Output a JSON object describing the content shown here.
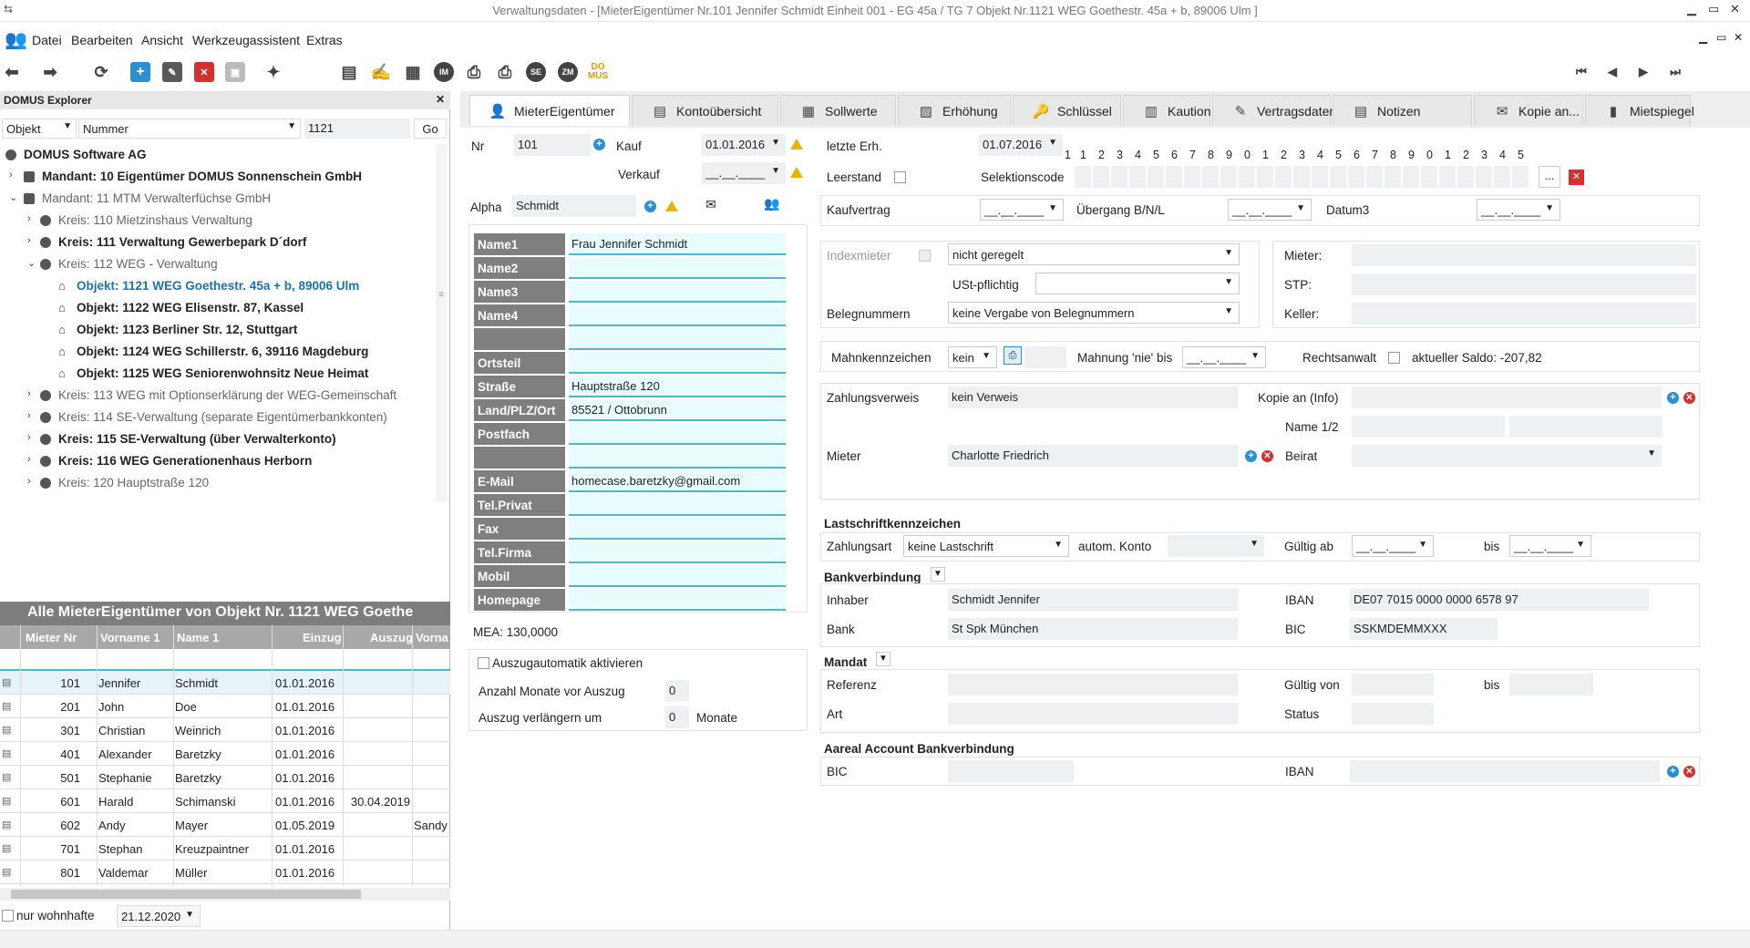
{
  "window": {
    "title": "Verwaltungsdaten - [MieterEigentümer Nr.101   Jennifer  Schmidt     Einheit   001 - EG  45a / TG 7     Objekt   Nr.1121   WEG Goethestr. 45a + b, 89006 Ulm ]"
  },
  "menu": [
    "Datei",
    "Bearbeiten",
    "Ansicht",
    "Werkzeugassistent",
    "Extras"
  ],
  "toolbar": {
    "badges": [
      "IM",
      "SE",
      "ZM"
    ],
    "logo": "DO MUS"
  },
  "explorer": {
    "header": "DOMUS Explorer",
    "filter": {
      "field": "Objekt",
      "mode": "Nummer",
      "value": "1121",
      "go": "Go"
    },
    "tree": [
      "DOMUS Software AG",
      "Mandant: 10 Eigentümer DOMUS Sonnenschein GmbH",
      "Mandant: 11 MTM Verwalterfüchse GmbH",
      "Kreis: 110 Mietzinshaus Verwaltung",
      "Kreis: 111 Verwaltung Gewerbepark D´dorf",
      "Kreis: 112 WEG - Verwaltung",
      "Objekt: 1121 WEG Goethestr. 45a + b, 89006 Ulm",
      "Objekt: 1122 WEG Elisenstr. 87, Kassel",
      "Objekt: 1123 Berliner Str. 12, Stuttgart",
      "Objekt: 1124 WEG Schillerstr. 6, 39116 Magdeburg",
      "Objekt: 1125 WEG Seniorenwohnsitz Neue Heimat",
      "Kreis: 113 WEG mit Optionserklärung der WEG-Gemeinschaft",
      "Kreis: 114 SE-Verwaltung (separate Eigentümerbankkonten)",
      "Kreis: 115 SE-Verwaltung (über Verwalterkonto)",
      "Kreis: 116 WEG Generationenhaus Herborn",
      "Kreis: 120 Hauptstraße 120"
    ],
    "grid": {
      "title": "Alle MieterEigentümer von Objekt Nr. 1121 WEG Goethe",
      "columns": [
        "Mieter Nr",
        "Vorname 1",
        "Name 1",
        "Einzug",
        "Auszug",
        "Vorna"
      ],
      "rows": [
        [
          "101",
          "Jennifer",
          "Schmidt",
          "01.01.2016",
          "",
          ""
        ],
        [
          "201",
          "John",
          "Doe",
          "01.01.2016",
          "",
          ""
        ],
        [
          "301",
          "Christian",
          "Weinrich",
          "01.01.2016",
          "",
          ""
        ],
        [
          "401",
          "Alexander",
          "Baretzky",
          "01.01.2016",
          "",
          ""
        ],
        [
          "501",
          "Stephanie",
          "Baretzky",
          "01.01.2016",
          "",
          ""
        ],
        [
          "601",
          "Harald",
          "Schimanski",
          "01.01.2016",
          "30.04.2019",
          ""
        ],
        [
          "602",
          "Andy",
          "Mayer",
          "01.05.2019",
          "",
          "Sandy"
        ],
        [
          "701",
          "Stephan",
          "Kreuzpaintner",
          "01.01.2016",
          "",
          ""
        ],
        [
          "801",
          "Valdemar",
          "Müller",
          "01.01.2016",
          "",
          ""
        ]
      ]
    },
    "footer": {
      "only_residents": "nur wohnhafte",
      "date": "21.12.2020"
    }
  },
  "tabs": [
    "MieterEigentümer",
    "Kontoübersicht",
    "Sollwerte",
    "Erhöhung",
    "Schlüssel",
    "Kaution",
    "Vertragsdaten",
    "Notizen",
    "Kopie an...",
    "Mietspiegel"
  ],
  "form": {
    "nr_label": "Nr",
    "nr": "101",
    "kauf_label": "Kauf",
    "kauf": "01.01.2016",
    "verkauf_label": "Verkauf",
    "verkauf": "__.__.____",
    "alpha_label": "Alpha",
    "alpha": "Schmidt",
    "letzte_erh_label": "letzte Erh.",
    "letzte_erh": "01.07.2016",
    "leerstand_label": "Leerstand",
    "selektionscode_label": "Selektionscode",
    "sel_numbers": [
      "1",
      "2",
      "3",
      "4",
      "5",
      "6",
      "7",
      "8",
      "9",
      "0",
      "1",
      "2",
      "3",
      "4",
      "5",
      "6",
      "7",
      "8",
      "9",
      "0",
      "1",
      "2",
      "3",
      "4",
      "5"
    ],
    "sel_more": "...",
    "kaufvertrag_label": "Kaufvertrag",
    "kaufvertrag": "__.__.____",
    "uebergang_label": "Übergang B/N/L",
    "uebergang": "__.__.____",
    "datum3_label": "Datum3",
    "datum3": "__.__.____",
    "name_labels": [
      "Name1",
      "Name2",
      "Name3",
      "Name4",
      "",
      "Ortsteil",
      "Straße",
      "Land/PLZ/Ort",
      "Postfach",
      "",
      "E-Mail",
      "Tel.Privat",
      "Fax",
      "Tel.Firma",
      "Mobil",
      "Homepage"
    ],
    "name_values": [
      "Frau Jennifer Schmidt",
      "",
      "",
      "",
      "",
      "",
      "Hauptstraße 120",
      "85521 / Ottobrunn",
      "",
      "",
      "homecase.baretzky@gmail.com",
      "",
      "",
      "",
      "",
      ""
    ],
    "mea": "MEA: 130,0000",
    "auszugautomatik": "Auszugautomatik aktivieren",
    "anzahl_monate_label": "Anzahl Monate vor Auszug",
    "anzahl_monate": "0",
    "auszug_verlaengern_label": "Auszug verlängern um",
    "auszug_verlaengern": "0",
    "monate": "Monate",
    "indexmieter_label": "Indexmieter",
    "indexmieter": "nicht geregelt",
    "ust_label": "USt-pflichtig",
    "ust": "",
    "belegnummern_label": "Belegnummern",
    "belegnummern": "keine Vergabe von Belegnummern",
    "mieter_label": "Mieter:",
    "stp_label": "STP:",
    "keller_label": "Keller:",
    "mahn_label": "Mahnkennzeichen",
    "mahn": "kein",
    "mahnung_nie_label": "Mahnung 'nie' bis",
    "mahnung_nie": "__.__.____",
    "rechtsanwalt_label": "Rechtsanwalt",
    "saldo": "aktueller Saldo: -207,82",
    "zahlungsverweis_label": "Zahlungsverweis",
    "zahlungsverweis": "kein Verweis",
    "kopie_label": "Kopie an (Info)",
    "name12_label": "Name 1/2",
    "mieter2_label": "Mieter",
    "mieter2": "Charlotte Friedrich",
    "beirat_label": "Beirat",
    "lastschrift_header": "Lastschriftkennzeichen",
    "zahlungsart_label": "Zahlungsart",
    "zahlungsart": "keine Lastschrift",
    "autom_konto_label": "autom. Konto",
    "gueltig_ab_label": "Gültig ab",
    "gueltig_ab": "__.__.____",
    "bis_label": "bis",
    "bis": "__.__.____",
    "bank_header": "Bankverbindung",
    "inhaber_label": "Inhaber",
    "inhaber": "Schmidt Jennifer",
    "iban_label": "IBAN",
    "iban": "DE07 7015 0000 0000 6578 97",
    "bank_label": "Bank",
    "bank": "St Spk München",
    "bic_label": "BIC",
    "bic": "SSKMDEMMXXX",
    "mandat_header": "Mandat",
    "referenz_label": "Referenz",
    "gueltig_von_label": "Gültig von",
    "mandat_bis_label": "bis",
    "art_label": "Art",
    "status_label": "Status",
    "aareal_header": "Aareal Account Bankverbindung",
    "aareal_bic_label": "BIC",
    "aareal_iban_label": "IBAN"
  }
}
